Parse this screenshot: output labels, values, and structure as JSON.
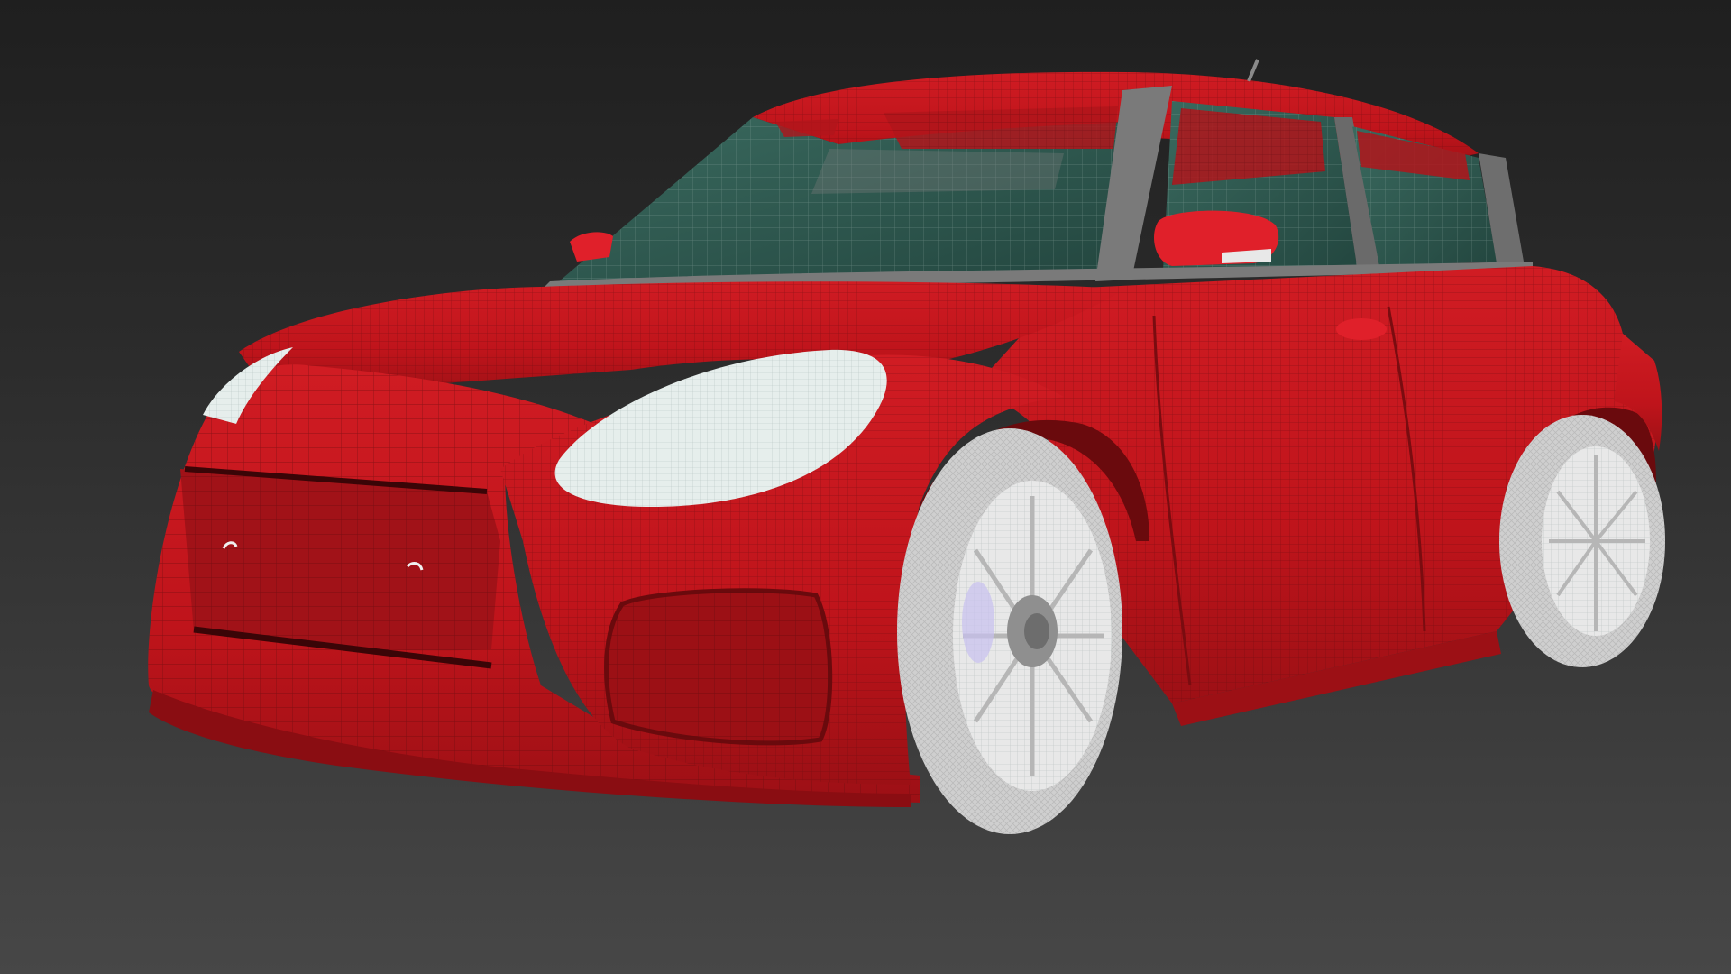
{
  "viewport": {
    "background_top": "#1f1f1f",
    "background_bottom": "#474747"
  },
  "model": {
    "body_color": "#c4161c",
    "body_shadow_color": "#8e0f14",
    "glass_color": "#2f5a50",
    "trim_color": "#6b6b6b",
    "headlight_color": "#e6eeec",
    "wheel_color": "#dcdcdc",
    "wireframe_color": "#5a0a0d"
  }
}
